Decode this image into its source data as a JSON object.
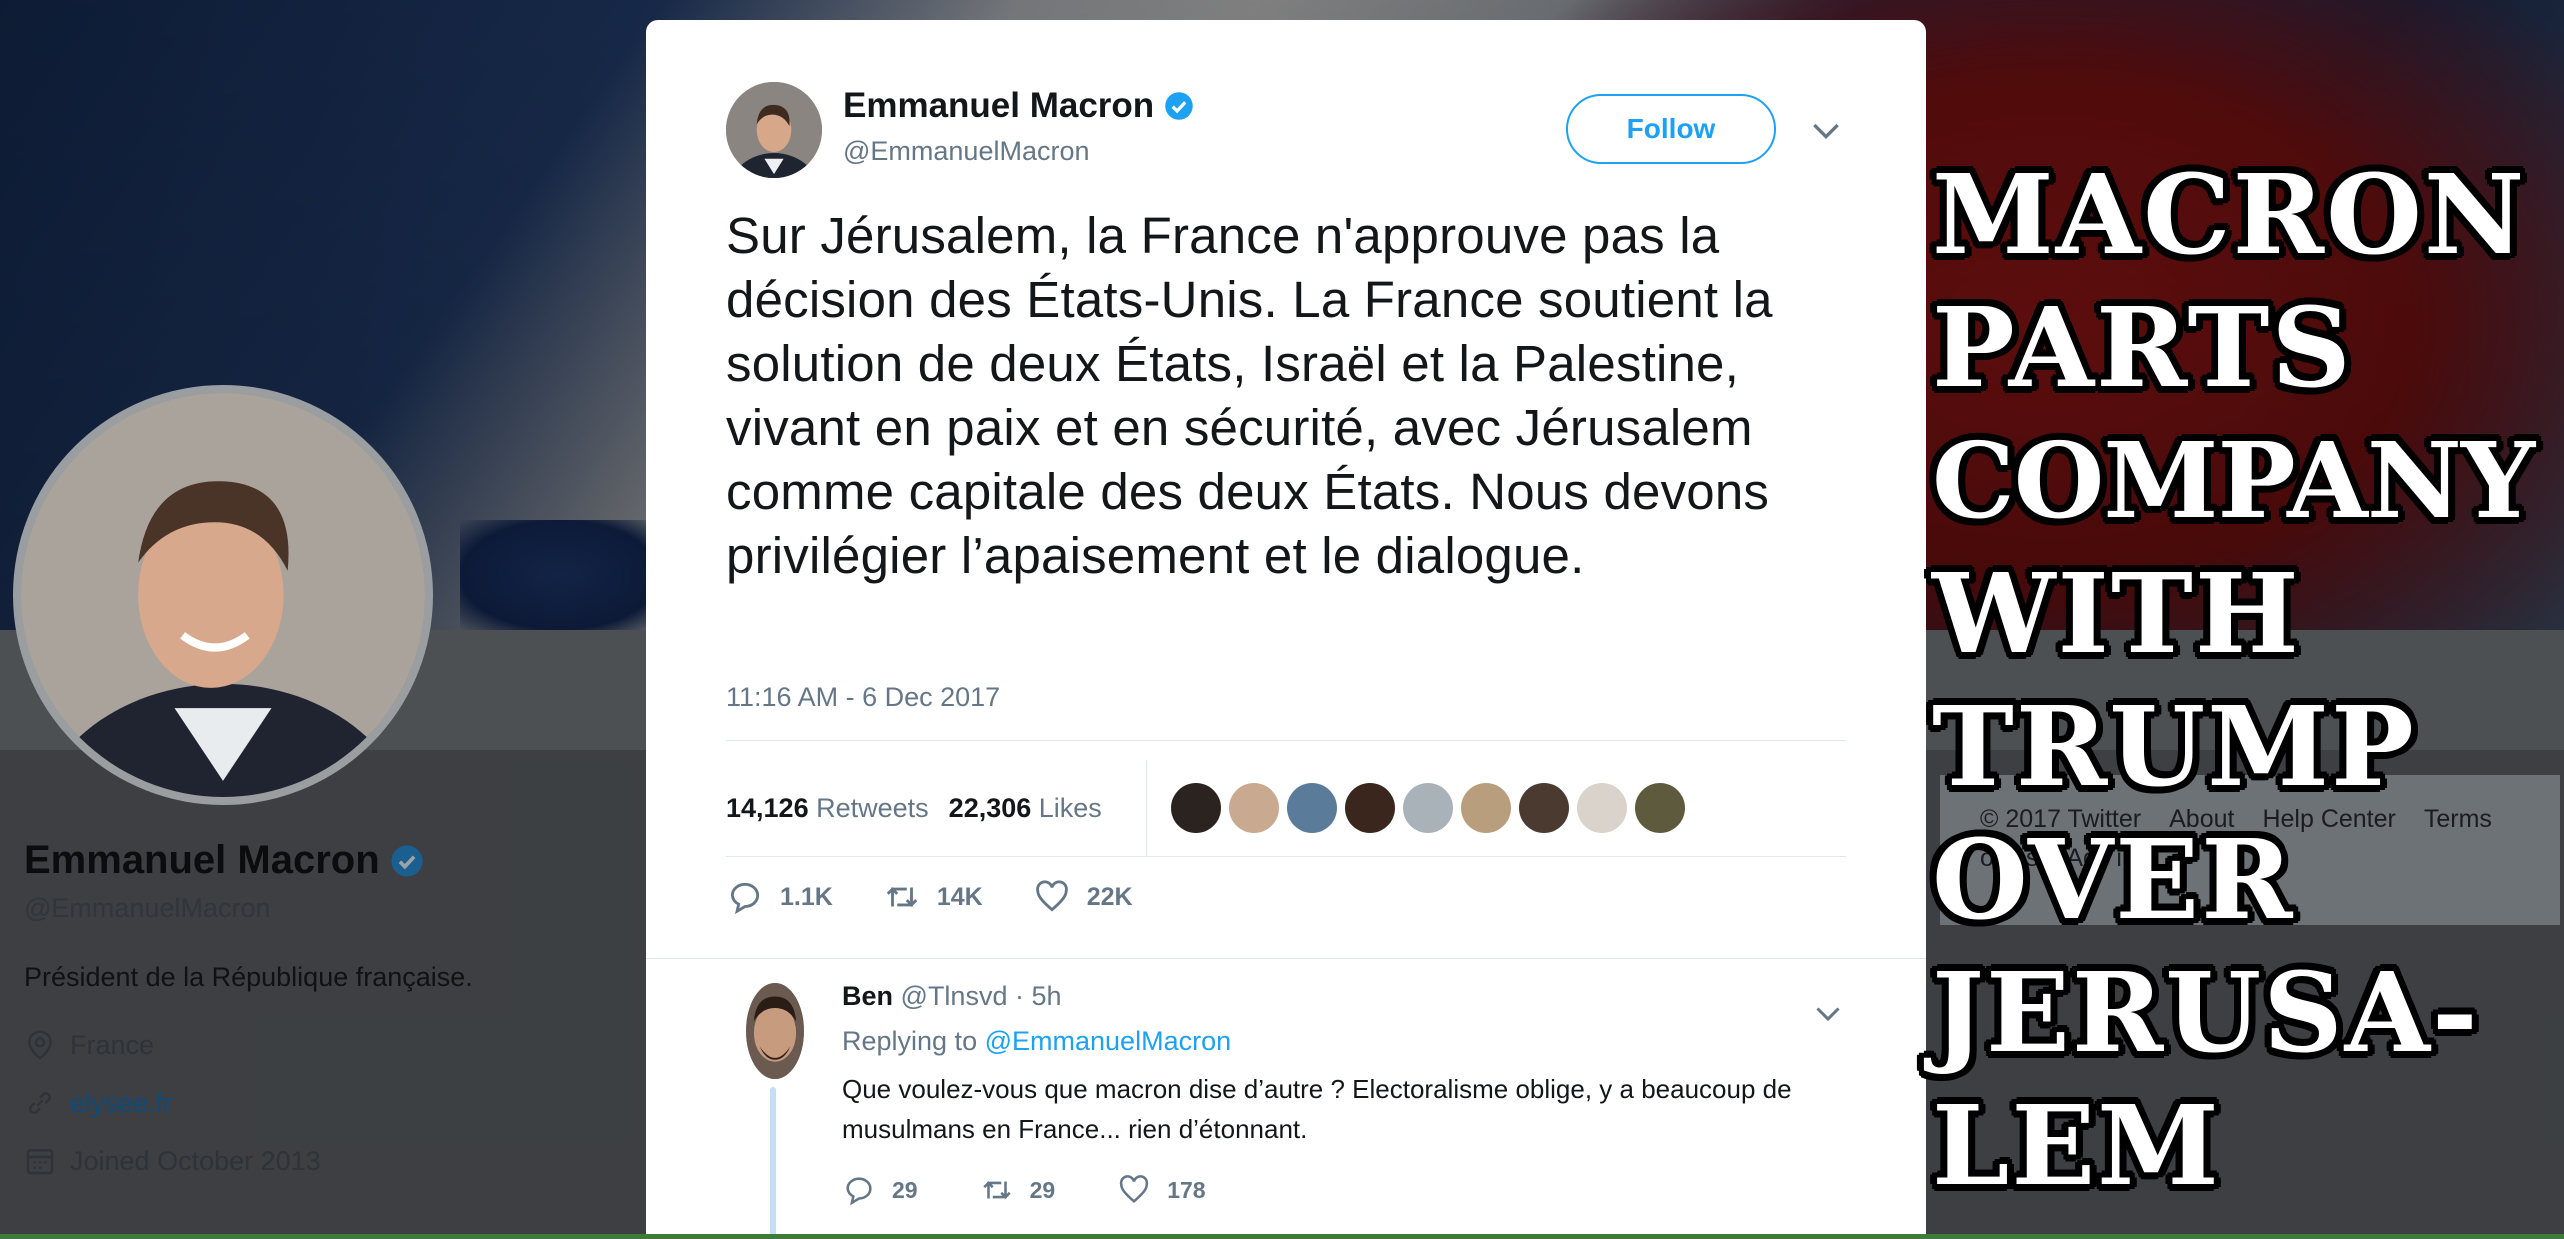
{
  "profile": {
    "name": "Emmanuel Macron",
    "handle": "@EmmanuelMacron",
    "bio": "Président de la République française.",
    "location": "France",
    "website": "elysee.fr",
    "joined": "Joined October 2013"
  },
  "footer": {
    "links": [
      "© 2017 Twitter",
      "About",
      "Help Center",
      "Terms",
      "okies",
      "Ads info"
    ]
  },
  "tweet": {
    "author_name": "Emmanuel Macron",
    "author_handle": "@EmmanuelMacron",
    "follow_label": "Follow",
    "text": "Sur Jérusalem, la France n'approuve pas la décision des États-Unis. La France soutient la solution de deux États, Israël et la Palestine, vivant en paix et en sécurité, avec Jérusalem comme capitale des deux États. Nous devons privilégier l’apaisement et le dialogue.",
    "timestamp": "11:16 AM - 6 Dec 2017",
    "retweets_count": "14,126",
    "retweets_label": "Retweets",
    "likes_count": "22,306",
    "likes_label": "Likes",
    "actions": {
      "replies": "1.1K",
      "retweets": "14K",
      "likes": "22K"
    }
  },
  "reply": {
    "name": "Ben",
    "handle": "@Tlnsvd",
    "age": "· 5h",
    "replying_prefix": "Replying to",
    "replying_to": "@EmmanuelMacron",
    "text": "Que voulez-vous que macron dise d’autre ? Electoralisme oblige, y a beaucoup de musulmans en France... rien d’étonnant.",
    "actions": {
      "replies": "29",
      "retweets": "29",
      "likes": "178"
    }
  },
  "headline": {
    "lines": [
      "MACRON",
      "PARTS",
      "COMPANY",
      "WITH",
      "TRUMP",
      "OVER",
      "JERUSA-",
      "LEM"
    ]
  },
  "colors": {
    "twitter_blue": "#1da1f2",
    "secondary_text": "#657786",
    "primary_text": "#14171a"
  },
  "icons": {
    "verified": "verified-badge-icon",
    "location": "map-pin-icon",
    "link": "link-icon",
    "calendar": "calendar-icon",
    "reply": "reply-icon",
    "retweet": "retweet-icon",
    "like": "heart-icon",
    "more": "chevron-down-icon"
  }
}
